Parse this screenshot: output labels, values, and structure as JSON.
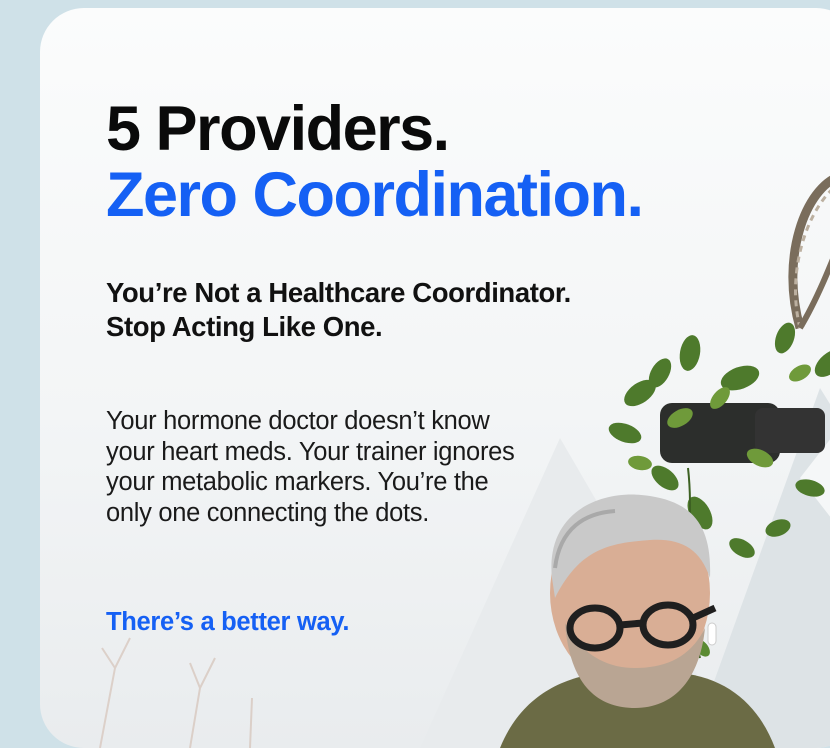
{
  "headline": {
    "line1": "5 Providers.",
    "line2": "Zero Coordination."
  },
  "subheadline": {
    "line1": "You’re Not a Healthcare Coordinator.",
    "line2": "Stop Acting Like One."
  },
  "body": "Your hormone doctor doesn’t know your heart meds. Your trainer ignores your metabolic markers. You’re the only one connecting the dots.",
  "cta": "There’s a better way.",
  "colors": {
    "accent": "#1560f4",
    "text": "#0a0a0a",
    "background": "#cfe1e8",
    "card": "#f6f7f8"
  },
  "icons": [
    "hanging-plant-illustration",
    "man-with-glasses-photo"
  ]
}
